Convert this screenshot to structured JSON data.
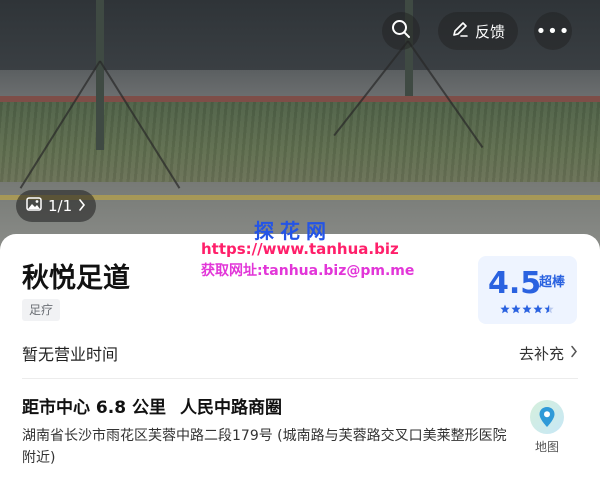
{
  "header": {
    "feedback_label": "反馈",
    "more_label": "•••",
    "photo_count": "1/1"
  },
  "watermark": {
    "title": "探花网",
    "url": "https://www.tanhua.biz",
    "mail": "获取网址:tanhua.biz@pm.me"
  },
  "place": {
    "name": "秋悦足道",
    "category": "足疗",
    "rating": {
      "score": "4.5",
      "label": "超棒",
      "stars": 4.5,
      "color": "#2a62e0"
    },
    "hours_text": "暂无营业时间",
    "supplement_label": "去补充",
    "distance_text": "距市中心 6.8 公里",
    "business_district": "人民中路商圈",
    "address": "湖南省长沙市雨花区芙蓉中路二段179号 (城南路与芙蓉路交叉口美莱整形医院附近)",
    "map_label": "地图"
  },
  "icons": [
    "search-icon",
    "edit-icon",
    "more-icon",
    "image-icon",
    "chevron-right-icon",
    "star-icon",
    "map-pin-icon"
  ]
}
